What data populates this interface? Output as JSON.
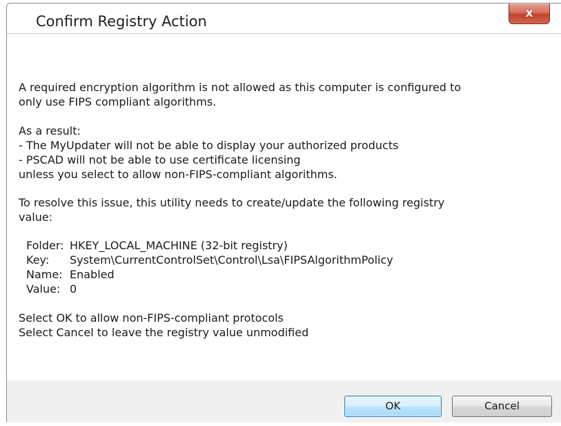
{
  "window": {
    "title": "Confirm Registry Action",
    "close_glyph": "x"
  },
  "message": {
    "intro_line1": "A required encryption algorithm is not allowed as this computer is configured to",
    "intro_line2": "only use FIPS compliant algorithms.",
    "result_heading": "As a result:",
    "result_item1": "- The MyUpdater will not be able to display your authorized products",
    "result_item2": "- PSCAD will not be able to use certificate licensing",
    "result_tail": "unless you select to allow non-FIPS-compliant algorithms.",
    "resolve_line1": "To resolve this issue, this utility needs to create/update the following registry",
    "resolve_line2": "value:",
    "registry": [
      {
        "label": "Folder:",
        "value": "HKEY_LOCAL_MACHINE (32-bit registry)"
      },
      {
        "label": "Key:",
        "value": "System\\CurrentControlSet\\Control\\Lsa\\FIPSAlgorithmPolicy"
      },
      {
        "label": "Name:",
        "value": "Enabled"
      },
      {
        "label": "Value:",
        "value": "0"
      }
    ],
    "select_ok": "Select OK to allow non-FIPS-compliant protocols",
    "select_cancel": "Select Cancel to leave the registry value unmodified"
  },
  "buttons": {
    "ok_label": "OK",
    "cancel_label": "Cancel"
  },
  "colors": {
    "close_button": "#c2412b",
    "ok_button_border": "#3c7fb1",
    "button_panel": "#f0f0f0"
  }
}
